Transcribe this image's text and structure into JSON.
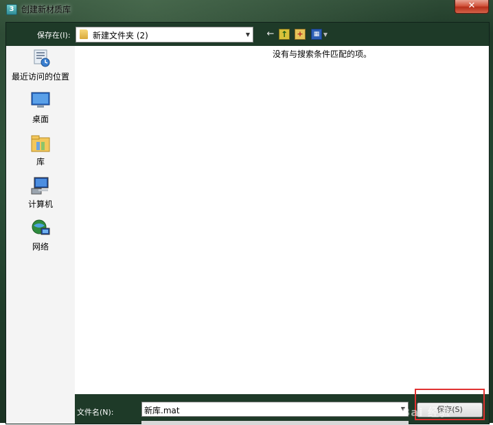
{
  "window": {
    "title": "创建新材质库",
    "icon_text": "3",
    "close_glyph": "✕"
  },
  "toolbar": {
    "save_in_label": "保存在(I):",
    "location": "新建文件夹 (2)",
    "back_glyph": "←",
    "up_glyph": "↑",
    "new_folder_glyph": "+",
    "view_glyph": "▦",
    "dropdown_glyph": "▼"
  },
  "places": {
    "items": [
      {
        "label": "最近访问的位置",
        "icon": "recent-places-icon"
      },
      {
        "label": "桌面",
        "icon": "desktop-icon"
      },
      {
        "label": "库",
        "icon": "libraries-icon"
      },
      {
        "label": "计算机",
        "icon": "computer-icon"
      },
      {
        "label": "网络",
        "icon": "network-icon"
      }
    ]
  },
  "file_list": {
    "empty_message": "没有与搜索条件匹配的项。"
  },
  "footer": {
    "filename_label": "文件名(N):",
    "filename_value": "新库.mat",
    "save_label": "保存(S)"
  },
  "watermark": {
    "text": "Bai 经验"
  },
  "colors": {
    "frame": "#1e3a28",
    "highlight": "#e03030",
    "close": "#c7402a"
  }
}
